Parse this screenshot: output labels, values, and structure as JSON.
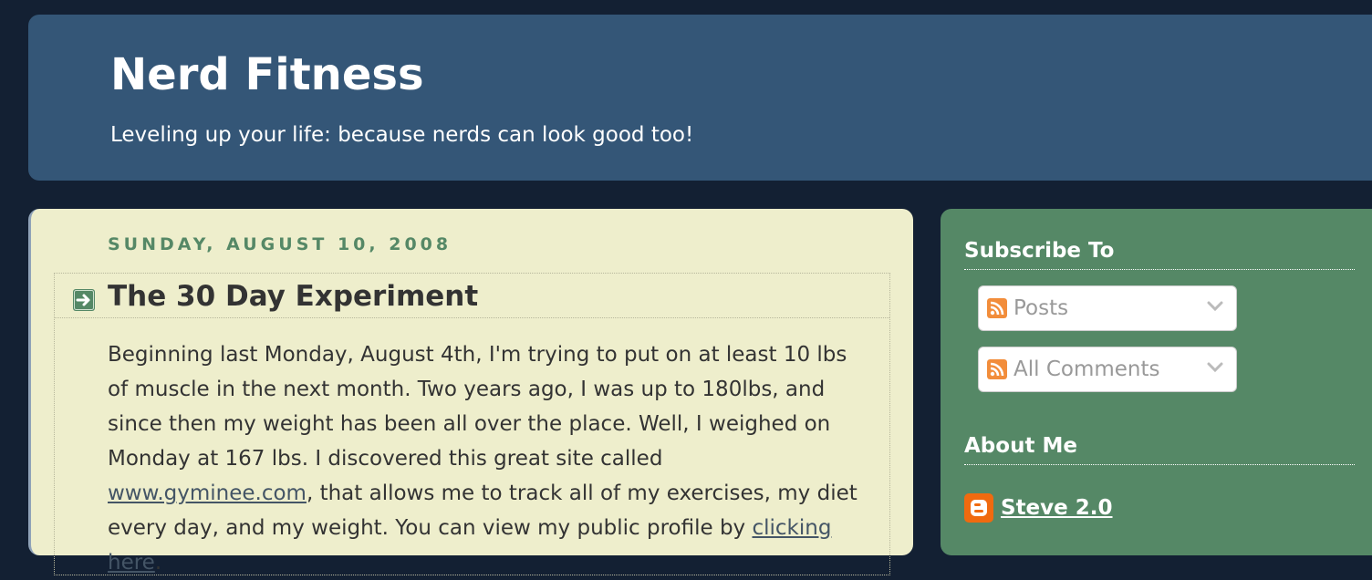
{
  "header": {
    "title": "Nerd Fitness",
    "description": "Leveling up your life: because nerds can look good too!"
  },
  "post": {
    "date": "SUNDAY, AUGUST 10, 2008",
    "title": "The 30 Day Experiment",
    "body_1": "Beginning last Monday, August 4th, I'm trying to put on at least 10 lbs of muscle in the next month. Two years ago, I was up to 180lbs, and since then my weight has been all over the place. Well, I weighed on Monday at 167 lbs. I discovered this great site called ",
    "link_1": "www.gyminee.com",
    "body_2": ", that allows me to track all of my exercises, my diet every day, and my weight. You can view my public profile by ",
    "link_2": "clicking here",
    "body_3": "."
  },
  "sidebar": {
    "subscribe_title": "Subscribe To",
    "feeds": [
      {
        "label": "Posts"
      },
      {
        "label": "All Comments"
      }
    ],
    "about_title": "About Me",
    "profile_name": "Steve 2.0"
  },
  "icons": {
    "post_arrow": "arrow-right-icon",
    "feed": "rss-feed-icon",
    "dropdown": "chevron-down-icon",
    "profile": "blogger-icon"
  },
  "colors": {
    "background": "#132033",
    "header": "#345677",
    "post_bg": "#eeeecc",
    "sidebar": "#558866",
    "date": "#558866",
    "rss": "#f28d3b",
    "blogger": "#f06a0f"
  }
}
